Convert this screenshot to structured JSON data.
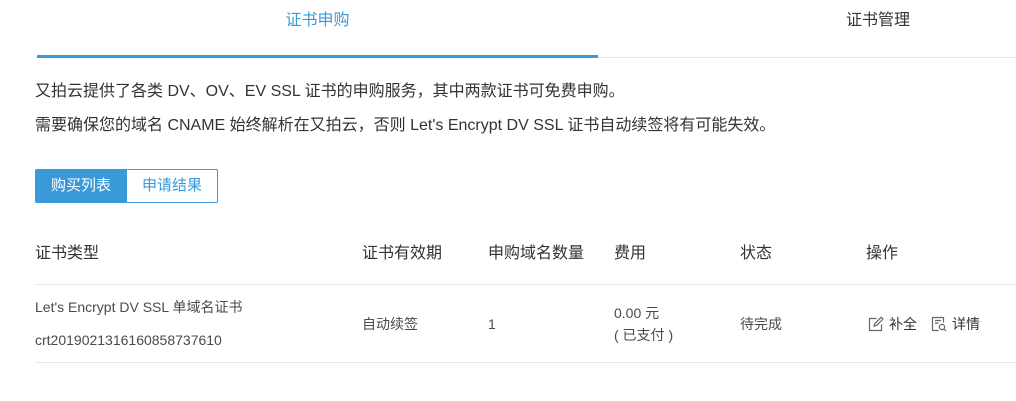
{
  "colors": {
    "accent": "#3a9ad9",
    "text": "#333333",
    "muted": "#4a4a4a",
    "border": "#e9e9e9"
  },
  "tabs": [
    {
      "label": "证书申购",
      "active": true
    },
    {
      "label": "证书管理",
      "active": false
    }
  ],
  "intro": {
    "line1": "又拍云提供了各类 DV、OV、EV SSL 证书的申购服务，其中两款证书可免费申购。",
    "line2": "需要确保您的域名 CNAME 始终解析在又拍云，否则 Let's Encrypt DV SSL 证书自动续签将有可能失效。"
  },
  "segments": [
    {
      "label": "购买列表",
      "active": true
    },
    {
      "label": "申请结果",
      "active": false
    }
  ],
  "table": {
    "columns": [
      "证书类型",
      "证书有效期",
      "申购域名数量",
      "费用",
      "状态",
      "操作"
    ],
    "rows": [
      {
        "type_name": "Let's Encrypt DV SSL 单域名证书",
        "cert_id": "crt2019021316160858737610",
        "validity": "自动续签",
        "domain_count": "1",
        "fee": "0.00 元",
        "payment_status": "( 已支付 )",
        "status": "待完成",
        "actions": [
          {
            "label": "补全",
            "icon": "edit-icon"
          },
          {
            "label": "详情",
            "icon": "document-search-icon"
          }
        ]
      }
    ]
  }
}
